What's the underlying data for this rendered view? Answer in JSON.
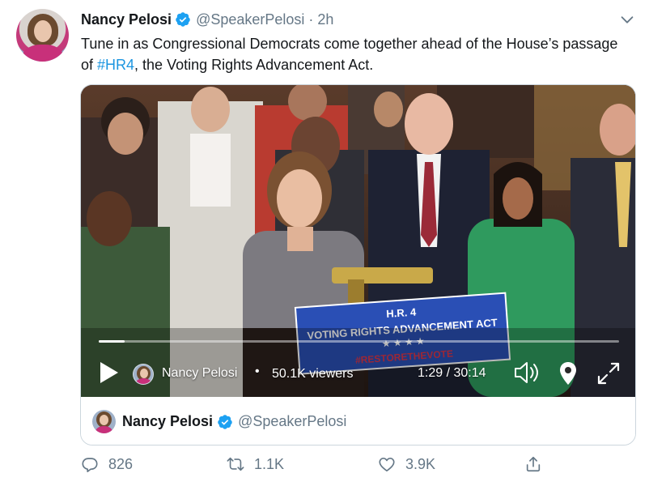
{
  "tweet": {
    "author_name": "Nancy Pelosi",
    "author_handle": "@SpeakerPelosi",
    "separator": "·",
    "time": "2h",
    "text_before": "Tune in as Congressional Democrats come together ahead of the House’s passage of ",
    "hashtag": "#HR4",
    "text_after": ", the Voting Rights Advancement Act."
  },
  "video": {
    "sign_line1": "H.R. 4",
    "sign_line2": "VOTING RIGHTS ADVANCEMENT ACT",
    "sign_line3": "#RESTORETHEVOTE",
    "broadcaster_name": "Nancy Pelosi",
    "live_separator": "•",
    "viewers": "50.1K viewers",
    "timecode": "1:29 / 30:14",
    "progress": 0.05
  },
  "card_footer": {
    "name": "Nancy Pelosi",
    "handle": "@SpeakerPelosi"
  },
  "actions": {
    "replies": "826",
    "retweets": "1.1K",
    "likes": "3.9K"
  },
  "colors": {
    "accent": "#1b95e0",
    "verified": "#1da1f2",
    "muted": "#657786",
    "border": "#ccd6dd"
  },
  "icons": [
    "verified-badge-icon",
    "chevron-down-icon",
    "play-icon",
    "volume-icon",
    "location-pin-icon",
    "fullscreen-icon",
    "reply-icon",
    "retweet-icon",
    "like-icon",
    "share-icon"
  ]
}
